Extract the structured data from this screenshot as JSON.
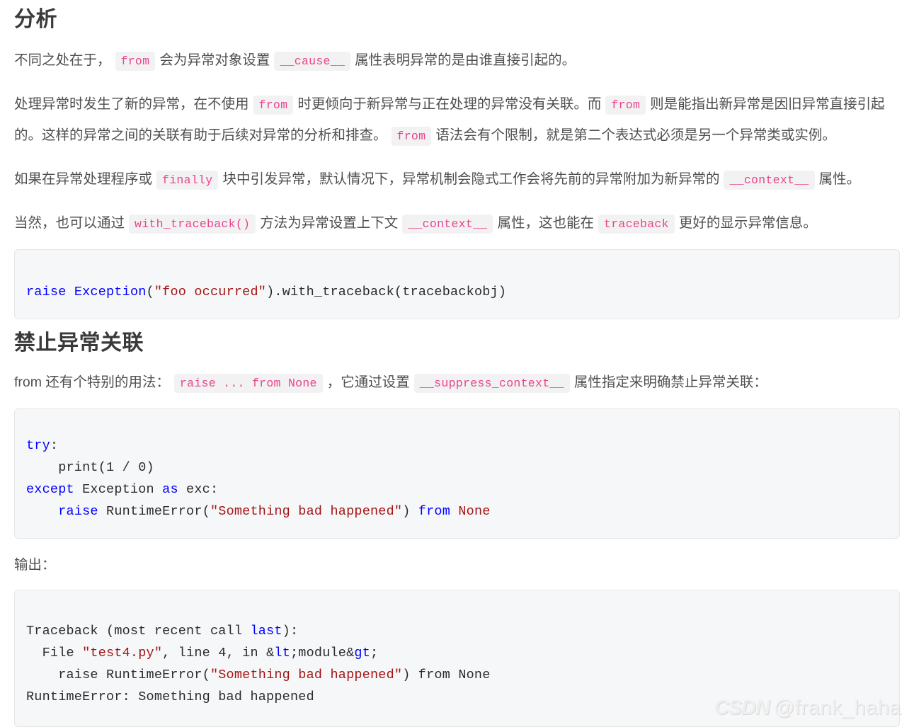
{
  "document": {
    "section1_heading": "分析",
    "section2_heading": "禁止异常关联",
    "output_label": "输出："
  },
  "paragraph1": {
    "t1": "不同之处在于，",
    "code1": "from",
    "t2": "会为异常对象设置",
    "code2": "__cause__",
    "t3": "属性表明异常的是由谁直接引起的。"
  },
  "paragraph2": {
    "t1": "处理异常时发生了新的异常，在不使用",
    "code1": "from",
    "t2": "时更倾向于新异常与正在处理的异常没有关联。而",
    "code2": "from",
    "t3": "则是能指出新异常是因旧异常直接引起的。这样的异常之间的关联有助于后续对异常的分析和排查。",
    "code3": "from",
    "t4": "语法会有个限制，就是第二个表达式必须是另一个异常类或实例。"
  },
  "paragraph3": {
    "t1": "如果在异常处理程序或",
    "code1": "finally",
    "t2": "块中引发异常，默认情况下，异常机制会隐式工作会将先前的异常附加为新异常的",
    "code2": "__context__",
    "t3": "属性。"
  },
  "paragraph4": {
    "t1": "当然，也可以通过",
    "code1": "with_traceback()",
    "t2": "方法为异常设置上下文",
    "code2": "__context__",
    "t3": "属性，这也能在",
    "code3": "traceback",
    "t4": "更好的显示异常信息。"
  },
  "paragraph5": {
    "t1": "from 还有个特别的用法：",
    "code1": "raise ... from None",
    "t2": "，它通过设置",
    "code2": "__suppress_context__",
    "t3": "属性指定来明确禁止异常关联："
  },
  "code_block_1": {
    "language": "python",
    "tokens": [
      {
        "text": "raise",
        "type": "keyword"
      },
      {
        "text": " ",
        "type": "plain"
      },
      {
        "text": "Exception",
        "type": "keyword"
      },
      {
        "text": "(",
        "type": "plain"
      },
      {
        "text": "\"foo occurred\"",
        "type": "string"
      },
      {
        "text": ").with_traceback(tracebackobj)",
        "type": "plain"
      }
    ],
    "plain_text": "raise Exception(\"foo occurred\").with_traceback(tracebackobj)"
  },
  "code_block_2": {
    "language": "python",
    "lines": [
      [
        {
          "text": "try",
          "type": "keyword"
        },
        {
          "text": ":",
          "type": "plain"
        }
      ],
      [
        {
          "text": "    print(1 / 0)",
          "type": "plain"
        }
      ],
      [
        {
          "text": "except",
          "type": "keyword"
        },
        {
          "text": " Exception ",
          "type": "plain"
        },
        {
          "text": "as",
          "type": "keyword"
        },
        {
          "text": " exc:",
          "type": "plain"
        }
      ],
      [
        {
          "text": "    ",
          "type": "plain"
        },
        {
          "text": "raise",
          "type": "keyword"
        },
        {
          "text": " RuntimeError(",
          "type": "plain"
        },
        {
          "text": "\"Something bad happened\"",
          "type": "string"
        },
        {
          "text": ") ",
          "type": "plain"
        },
        {
          "text": "from",
          "type": "keyword"
        },
        {
          "text": " ",
          "type": "plain"
        },
        {
          "text": "None",
          "type": "literal"
        }
      ]
    ],
    "plain_text": "try:\n    print(1 / 0)\nexcept Exception as exc:\n    raise RuntimeError(\"Something bad happened\") from None"
  },
  "code_block_3": {
    "language": "traceback",
    "lines": [
      [
        {
          "text": "Traceback (most recent call ",
          "type": "plain"
        },
        {
          "text": "last",
          "type": "keyword"
        },
        {
          "text": "):",
          "type": "plain"
        }
      ],
      [
        {
          "text": "  File ",
          "type": "plain"
        },
        {
          "text": "\"test4.py\"",
          "type": "string"
        },
        {
          "text": ", line 4, in &",
          "type": "plain"
        },
        {
          "text": "lt",
          "type": "keyword"
        },
        {
          "text": ";module&",
          "type": "plain"
        },
        {
          "text": "gt",
          "type": "keyword"
        },
        {
          "text": ";",
          "type": "plain"
        }
      ],
      [
        {
          "text": "    raise RuntimeError(",
          "type": "plain"
        },
        {
          "text": "\"Something bad happened\"",
          "type": "string"
        },
        {
          "text": ") from None",
          "type": "plain"
        }
      ],
      [
        {
          "text": "RuntimeError: Something bad happened",
          "type": "plain"
        }
      ]
    ],
    "plain_text": "Traceback (most recent call last):\n  File \"test4.py\", line 4, in &lt;module&gt;\n    raise RuntimeError(\"Something bad happened\") from None\nRuntimeError: Something bad happened"
  },
  "watermark": {
    "brand": "CSDN",
    "user": "@frank_haha"
  },
  "colors": {
    "text": "#4f4f4f",
    "heading": "#3a3a3a",
    "inline_code_text": "#e8458f",
    "inline_code_bg": "#f2f2f2",
    "codeblock_bg": "#f6f7f8",
    "codeblock_border": "#e6e6e6",
    "keyword": "#0000ff",
    "string": "#a31515"
  }
}
